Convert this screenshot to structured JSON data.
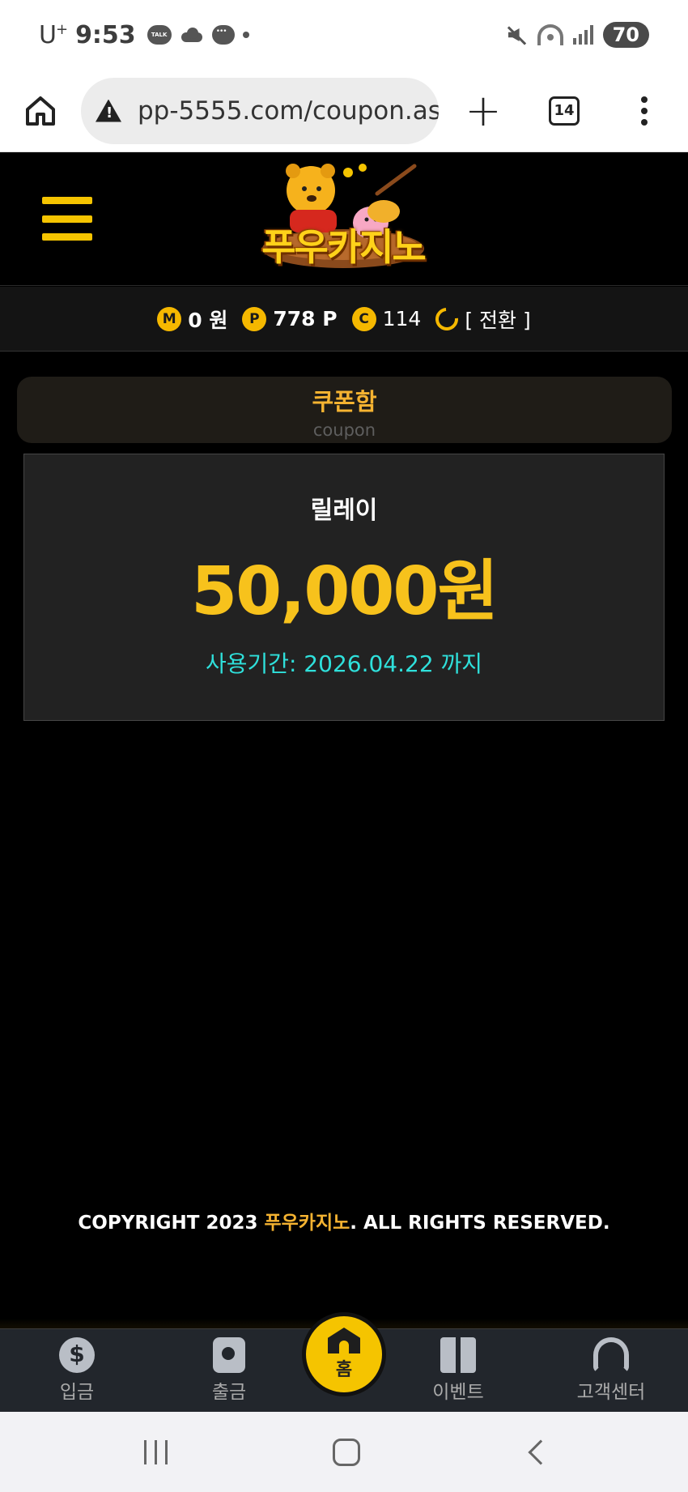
{
  "status_bar": {
    "carrier": "U",
    "carrier_suffix": "+",
    "time": "9:53",
    "talk_label": "TALK",
    "battery": "70",
    "icons": [
      "kakaotalk-icon",
      "cloud-icon",
      "message-icon",
      "dot-icon",
      "mute-icon",
      "wifi-icon",
      "signal-icon",
      "battery-icon"
    ]
  },
  "browser": {
    "url": "pp-5555.com/coupon.as",
    "tab_count": "14",
    "icons": [
      "home-icon",
      "warning-icon",
      "plus-icon",
      "tabs-icon",
      "more-vert-icon"
    ]
  },
  "site": {
    "logo_text": "푸우카지노",
    "accent_color": "#f5c400"
  },
  "balance": {
    "money_badge": "M",
    "money": "0 원",
    "point_badge": "P",
    "points": "778 P",
    "comp_badge": "C",
    "comp": "114",
    "convert_label": "[ 전환 ]"
  },
  "coupon_section": {
    "title": "쿠폰함",
    "subtitle": "coupon"
  },
  "coupon": {
    "name": "릴레이",
    "amount": "50,000원",
    "expiry": "사용기간: 2026.04.22 까지",
    "amount_color": "#f7c21c",
    "expiry_color": "#2fe0db"
  },
  "footer": {
    "copyright_prefix": "COPYRIGHT 2023 ",
    "brand": "푸우카지노",
    "copyright_suffix": ". ALL RIGHTS RESERVED."
  },
  "bottom_nav": {
    "items": [
      {
        "label": "입금",
        "icon": "deposit-icon"
      },
      {
        "label": "출금",
        "icon": "withdraw-icon"
      },
      {
        "label": "홈",
        "icon": "home-icon"
      },
      {
        "label": "이벤트",
        "icon": "gift-icon"
      },
      {
        "label": "고객센터",
        "icon": "headset-icon"
      }
    ]
  },
  "android_nav": {
    "icons": [
      "recents-icon",
      "home-icon",
      "back-icon"
    ]
  }
}
